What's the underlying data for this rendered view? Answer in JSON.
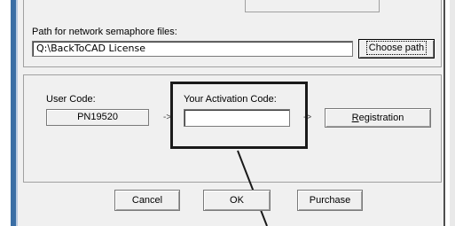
{
  "path_section": {
    "label": "Path for network semaphore files:",
    "path_value": "Q:\\BackToCAD License",
    "choose_button": "Choose path"
  },
  "activation_section": {
    "user_code_label": "User Code:",
    "user_code_value": "PN19520",
    "arrow_symbol": "->",
    "activation_label": "Your Activation Code:",
    "activation_value": "",
    "registration_button_first": "R",
    "registration_button_rest": "egistration"
  },
  "buttons": {
    "cancel": "Cancel",
    "ok": "OK",
    "purchase": "Purchase"
  }
}
